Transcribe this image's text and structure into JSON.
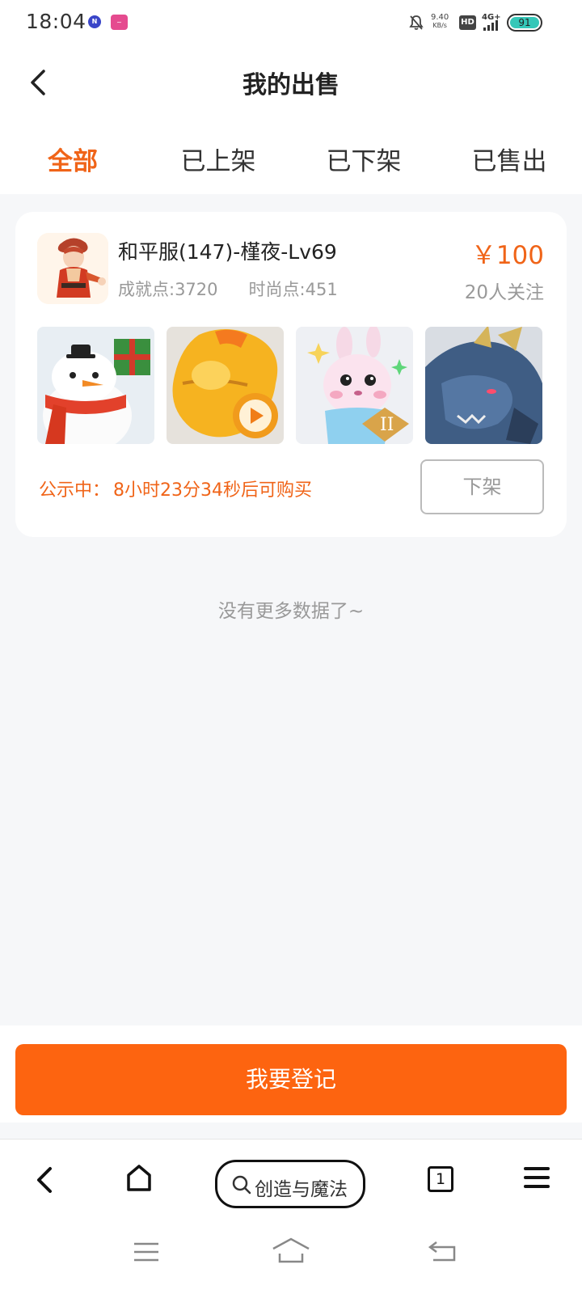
{
  "status_bar": {
    "time": "18:04",
    "net_speed_value": "9.40",
    "net_speed_unit": "KB/s",
    "hd_badge": "HD",
    "network": "4G+",
    "battery": "91"
  },
  "header": {
    "title": "我的出售"
  },
  "tabs": [
    {
      "label": "全部",
      "active": true
    },
    {
      "label": "已上架",
      "active": false
    },
    {
      "label": "已下架",
      "active": false
    },
    {
      "label": "已售出",
      "active": false
    }
  ],
  "listing": {
    "title": "和平服(147)-槿夜-Lv69",
    "achievement": "成就点:3720",
    "fashion": "时尚点:451",
    "price": "￥100",
    "followers": "20人关注",
    "notice_label": "公示中：",
    "notice_value": "8小时23分34秒后可购买",
    "delist_button": "下架",
    "thumbnails": [
      "snowman-pet",
      "golden-pig-pet",
      "pink-rabbit-pet",
      "blue-dragon-pet"
    ]
  },
  "no_more_text": "没有更多数据了~",
  "register_button": "我要登记",
  "browser_nav": {
    "search_label": "创造与魔法",
    "tab_count": "1"
  },
  "colors": {
    "accent": "#f06418",
    "button": "#fd6410",
    "background": "#f6f7f9"
  }
}
